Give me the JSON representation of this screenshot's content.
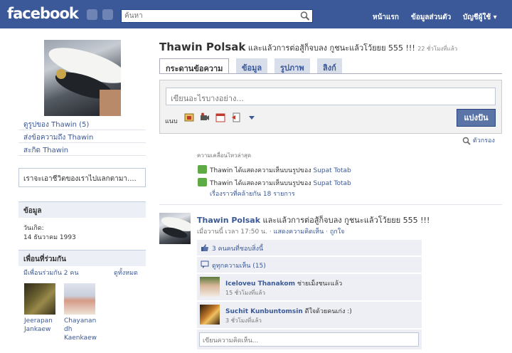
{
  "topbar": {
    "logo": "facebook",
    "search_placeholder": "ค้นหา",
    "links": [
      "หน้าแรก",
      "ข้อมูลส่วนตัว",
      "บัญชีผู้ใช้ ▾"
    ]
  },
  "left": {
    "links": [
      "ดูรูปของ Thawin (5)",
      "ส่งข้อความถึง Thawin",
      "สะกิด Thawin"
    ],
    "status_box": "เราจะเอาชีวิตของเราไปแลกตามา....",
    "info_header": "ข้อมูล",
    "birthday_label": "วันเกิด:",
    "birthday_value": "14 ธันวาคม 1993",
    "mutual_header": "เพื่อนที่ร่วมกัน",
    "mutual_count": "มีเพื่อนร่วมกัน 2 คน",
    "see_all": "ดูทั้งหมด",
    "friends": [
      {
        "name_l1": "Jeerapan",
        "name_l2": "Jankaew",
        "name_l3": ""
      },
      {
        "name_l1": "Chayanan",
        "name_l2": "dh",
        "name_l3": "Kaenkaew"
      }
    ]
  },
  "header": {
    "name": "Thawin Polsak",
    "status": " และแล้วการต่อสู้ก็จบลง กูชนะแล้วโว้ยยย 555 !!! ",
    "time": "22 ชั่วโมงที่แล้ว"
  },
  "tabs": [
    "กระดานข้อความ",
    "ข้อมูล",
    "รูปภาพ",
    "ลิงก์"
  ],
  "publisher": {
    "placeholder": "เขียนอะไรบางอย่าง...",
    "attach_label": "แนบ",
    "share_button": "แบ่งปัน"
  },
  "filter": "ตัวกรอง",
  "recent": {
    "heading": "ความเคลื่อนไหวล่าสุด",
    "items": [
      {
        "pre": "Thawin ได้แสดงความเห็นบนรูปของ ",
        "link": "Supat Totab"
      },
      {
        "pre": "Thawin ได้แสดงความเห็นบนรูปของ ",
        "link": "Supat Totab"
      }
    ],
    "more": "เรื่องราวที่คล้ายกัน 18 รายการ"
  },
  "post": {
    "name": "Thawin Polsak",
    "text": " และแล้วการต่อสู้ก็จบลง กูชนะแล้วโว้ยยย 555 !!!",
    "time": "เมื่อวานนี้ เวลา 17:50 น. · ",
    "comment_link": "แสดงความคิดเห็น",
    "like_link": "ถูกใจ",
    "likes": "3 คนคนที่ชอบสิ่งนี้",
    "view_comments": "ดูทุกความเห็น (15)",
    "comments": [
      {
        "name": "Iceloveu Thanakom",
        "text": " ช่ายเม็งชนะแล้ว",
        "time": "15 ชั่วโมงที่แล้ว"
      },
      {
        "name": "Suchit Kunbuntomsin",
        "text": " ดีใจด้วยคนเก่ง :)",
        "time": "3 ชั่วโมงที่แล้ว"
      }
    ],
    "comment_placeholder": "เขียนความคิดเห็น..."
  },
  "colors": {
    "brand": "#3b5998",
    "header_bg": "#3b5998",
    "share_button": "#5b74a8"
  }
}
